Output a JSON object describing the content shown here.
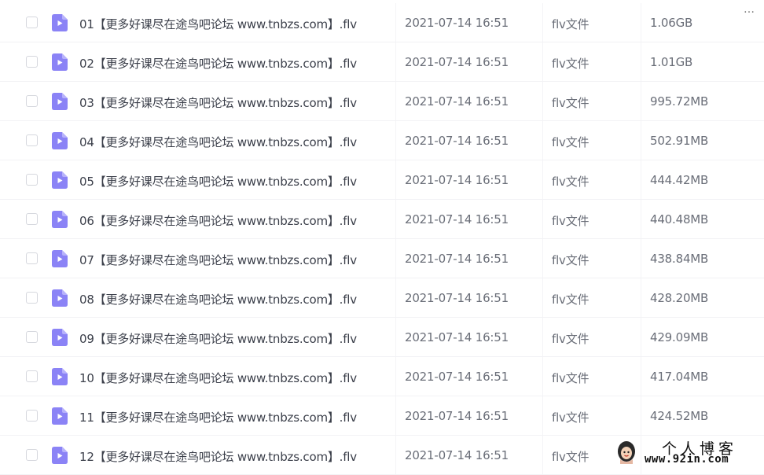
{
  "colors": {
    "file_icon": "#8b83f6",
    "text_primary": "#3b3f4a",
    "text_secondary": "#6a6e78"
  },
  "header_fragment": "…",
  "files": [
    {
      "name": "01【更多好课尽在途鸟吧论坛 www.tnbzs.com】.flv",
      "date": "2021-07-14 16:51",
      "type": "flv文件",
      "size": "1.06GB",
      "icon": "video-file-icon"
    },
    {
      "name": "02【更多好课尽在途鸟吧论坛 www.tnbzs.com】.flv",
      "date": "2021-07-14 16:51",
      "type": "flv文件",
      "size": "1.01GB",
      "icon": "video-file-icon"
    },
    {
      "name": "03【更多好课尽在途鸟吧论坛 www.tnbzs.com】.flv",
      "date": "2021-07-14 16:51",
      "type": "flv文件",
      "size": "995.72MB",
      "icon": "video-file-icon"
    },
    {
      "name": "04【更多好课尽在途鸟吧论坛 www.tnbzs.com】.flv",
      "date": "2021-07-14 16:51",
      "type": "flv文件",
      "size": "502.91MB",
      "icon": "video-file-icon"
    },
    {
      "name": "05【更多好课尽在途鸟吧论坛 www.tnbzs.com】.flv",
      "date": "2021-07-14 16:51",
      "type": "flv文件",
      "size": "444.42MB",
      "icon": "video-file-icon"
    },
    {
      "name": "06【更多好课尽在途鸟吧论坛 www.tnbzs.com】.flv",
      "date": "2021-07-14 16:51",
      "type": "flv文件",
      "size": "440.48MB",
      "icon": "video-file-icon"
    },
    {
      "name": "07【更多好课尽在途鸟吧论坛 www.tnbzs.com】.flv",
      "date": "2021-07-14 16:51",
      "type": "flv文件",
      "size": "438.84MB",
      "icon": "video-file-icon"
    },
    {
      "name": "08【更多好课尽在途鸟吧论坛 www.tnbzs.com】.flv",
      "date": "2021-07-14 16:51",
      "type": "flv文件",
      "size": "428.20MB",
      "icon": "video-file-icon"
    },
    {
      "name": "09【更多好课尽在途鸟吧论坛 www.tnbzs.com】.flv",
      "date": "2021-07-14 16:51",
      "type": "flv文件",
      "size": "429.09MB",
      "icon": "video-file-icon"
    },
    {
      "name": "10【更多好课尽在途鸟吧论坛 www.tnbzs.com】.flv",
      "date": "2021-07-14 16:51",
      "type": "flv文件",
      "size": "417.04MB",
      "icon": "video-file-icon"
    },
    {
      "name": "11【更多好课尽在途鸟吧论坛 www.tnbzs.com】.flv",
      "date": "2021-07-14 16:51",
      "type": "flv文件",
      "size": "424.52MB",
      "icon": "video-file-icon"
    },
    {
      "name": "12【更多好课尽在途鸟吧论坛 www.tnbzs.com】.flv",
      "date": "2021-07-14 16:51",
      "type": "flv文件",
      "size": "",
      "icon": "video-file-icon"
    }
  ],
  "watermark": {
    "title": "个人博客",
    "url": "www.92in.com"
  }
}
